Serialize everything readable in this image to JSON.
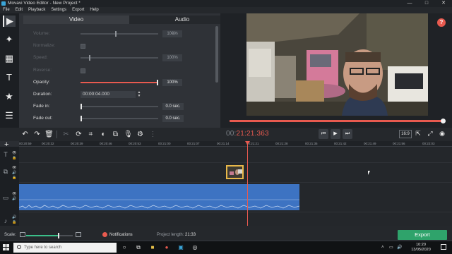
{
  "window": {
    "title": "Movavi Video Editor - New Project *",
    "controls": [
      "—",
      "□",
      "✕"
    ]
  },
  "menu": [
    "File",
    "Edit",
    "Playback",
    "Settings",
    "Export",
    "Help"
  ],
  "panel": {
    "tabs": [
      "Video",
      "Audio"
    ],
    "rows": {
      "volume": {
        "label": "Volume:",
        "value": "100%",
        "level": 0.5
      },
      "normalize": {
        "label": "Normalize:"
      },
      "speed": {
        "label": "Speed:",
        "value": "100%",
        "level": 0.12
      },
      "reverse": {
        "label": "Reverse:"
      },
      "opacity": {
        "label": "Opacity:",
        "value": "100%",
        "level": 1.0
      },
      "duration": {
        "label": "Duration:",
        "value": "00:00:04.000"
      },
      "fade_in": {
        "label": "Fade in:",
        "value": "0.0 sec."
      },
      "fade_out": {
        "label": "Fade out:",
        "value": "0.0 sec."
      }
    }
  },
  "preview": {
    "help": "?",
    "progress": 0.99
  },
  "timecode": {
    "dim": "00:",
    "red": "21:21.363"
  },
  "aspect": "16:9",
  "ruler_ticks": [
    "00:20:59",
    "00:20:32",
    "00:20:39",
    "00:20:46",
    "00:20:53",
    "00:21:00",
    "00:21:07",
    "00:21:14",
    "00:21:21",
    "00:21:28",
    "00:21:35",
    "00:21:42",
    "00:21:49",
    "00:21:56",
    "00:22:03"
  ],
  "bottom": {
    "scale_label": "Scale:",
    "scale_level": 0.7,
    "notifications": "Notifications",
    "project_length_label": "Project length:",
    "project_length_value": "21:33",
    "export": "Export"
  },
  "taskbar": {
    "search_placeholder": "Type here to search",
    "time": "10:20",
    "date": "13/05/2020"
  },
  "colors": {
    "accent": "#e85a4f",
    "export": "#2fa36b",
    "audio_clip": "#3d73c2",
    "clip_border": "#e8b84a"
  }
}
